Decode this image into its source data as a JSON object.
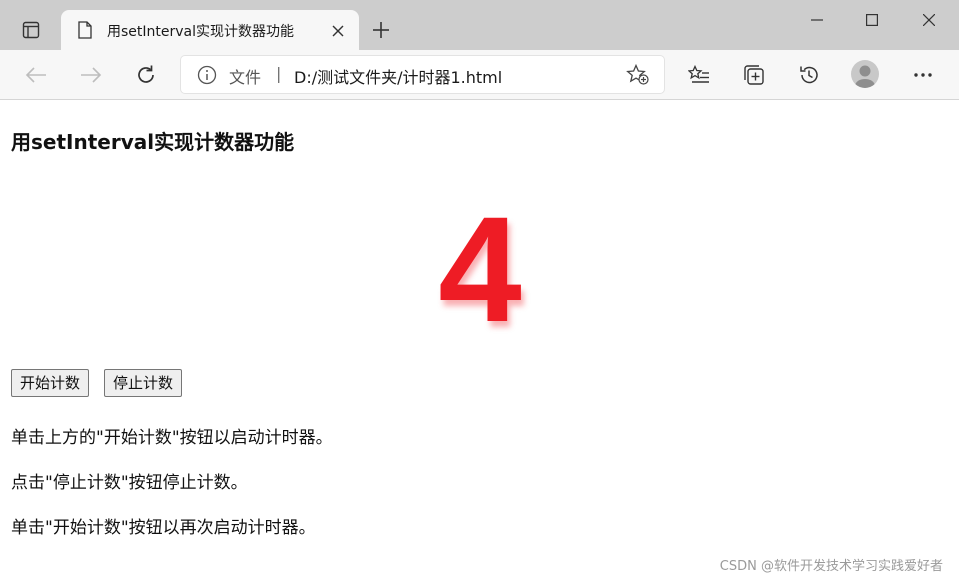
{
  "browser": {
    "tab": {
      "title": "用setInterval实现计数器功能"
    },
    "address_bar": {
      "site_info_label": "文件",
      "separator": "|",
      "url": "D:/测试文件夹/计时器1.html"
    },
    "icons": {
      "tab_actions": "tab-actions-icon",
      "page": "page-icon",
      "close": "close-icon",
      "new_tab": "plus-icon",
      "minimize": "minimize-icon",
      "maximize": "maximize-icon",
      "window_close": "window-close-icon",
      "back": "back-arrow-icon",
      "forward": "forward-arrow-icon",
      "refresh": "refresh-icon",
      "info": "info-icon",
      "add_favorite": "star-add-icon",
      "favorites": "favorites-icon",
      "collections": "collections-icon",
      "history": "history-icon",
      "profile": "profile-avatar",
      "more": "more-icon"
    }
  },
  "page": {
    "heading": "用setInterval实现计数器功能",
    "counter_value": "4",
    "counter_color": "#ee1c25",
    "buttons": {
      "start": "开始计数",
      "stop": "停止计数"
    },
    "instructions": [
      "单击上方的\"开始计数\"按钮以启动计时器。",
      "点击\"停止计数\"按钮停止计数。",
      "单击\"开始计数\"按钮以再次启动计时器。"
    ],
    "watermark": "CSDN @软件开发技术学习实践爱好者"
  }
}
